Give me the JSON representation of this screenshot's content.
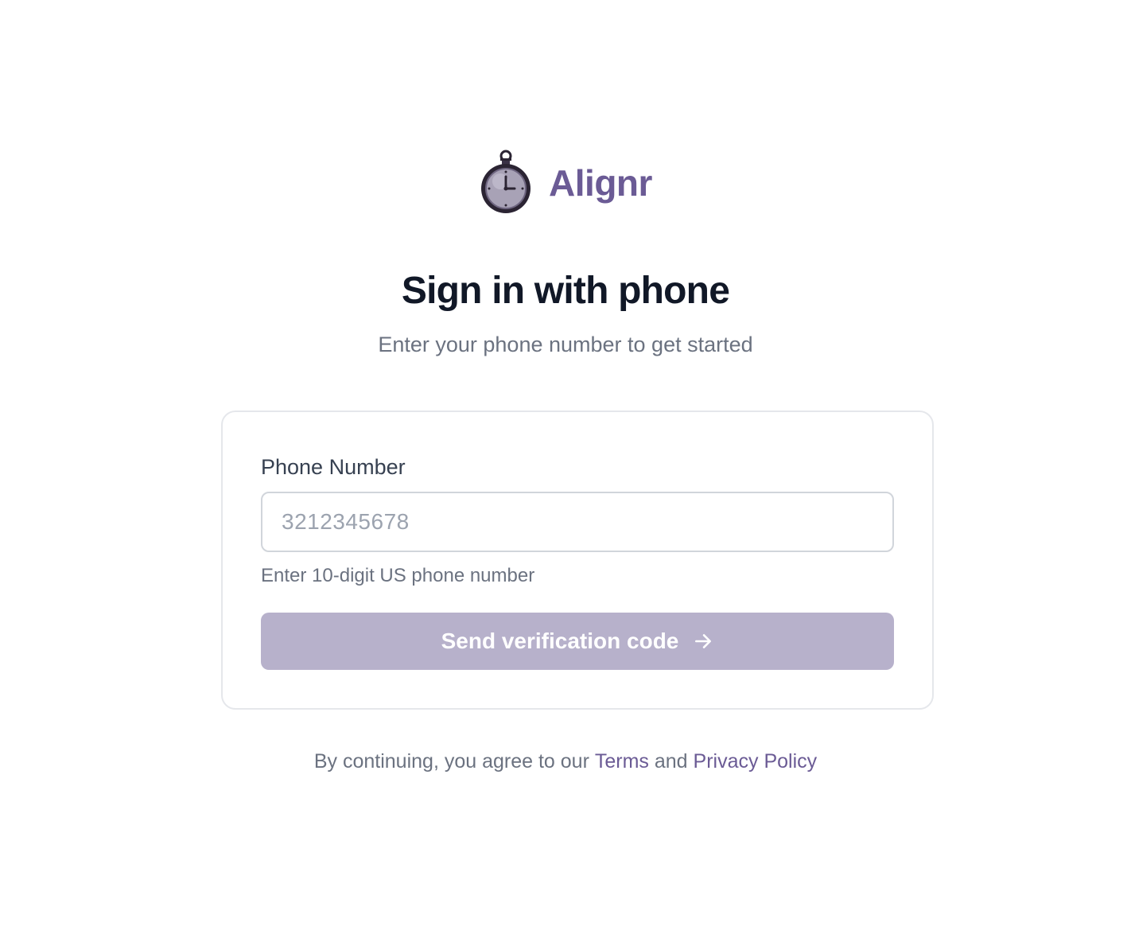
{
  "colors": {
    "brand": "#6b5b95",
    "button_disabled": "#b7b1cb",
    "link": "#6b5b95"
  },
  "brand": {
    "name": "Alignr",
    "logo_icon": "stopwatch-icon"
  },
  "header": {
    "title": "Sign in with phone",
    "subtitle": "Enter your phone number to get started"
  },
  "form": {
    "phone_label": "Phone Number",
    "phone_value": "",
    "phone_placeholder": "3212345678",
    "helper": "Enter 10-digit US phone number",
    "submit_label": "Send verification code",
    "submit_icon": "arrow-right-icon",
    "submit_disabled": true
  },
  "footer": {
    "prefix": "By continuing, you agree to our",
    "terms_label": "Terms",
    "conjunction": "and",
    "privacy_label": "Privacy Policy"
  }
}
